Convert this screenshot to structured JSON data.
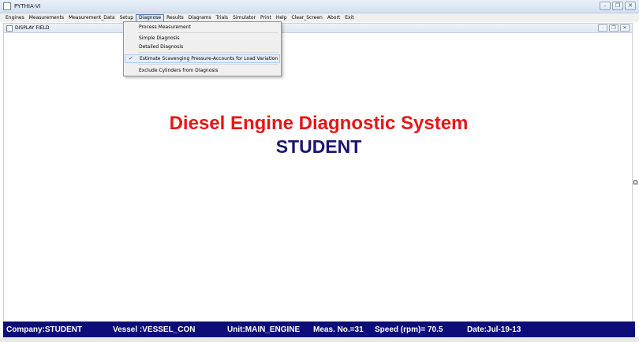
{
  "window": {
    "title": "PYTHIA-VI"
  },
  "menubar": {
    "items": [
      {
        "label": "Engines"
      },
      {
        "label": "Measurements"
      },
      {
        "label": "Measurement_Data"
      },
      {
        "label": "Setup"
      },
      {
        "label": "Diagnose"
      },
      {
        "label": "Results"
      },
      {
        "label": "Diagrams"
      },
      {
        "label": "Trials"
      },
      {
        "label": "Simulator"
      },
      {
        "label": "Print"
      },
      {
        "label": "Help"
      },
      {
        "label": "Clear_Screen"
      },
      {
        "label": "Abort"
      },
      {
        "label": "Exit"
      }
    ],
    "active": "Diagnose"
  },
  "diagnose_menu": {
    "items": [
      {
        "label": "Process Measurement"
      },
      {
        "label": "Simple Diagnosis"
      },
      {
        "label": "Detailed Diagnosis"
      },
      {
        "label": "Estimate Scavenging Pressure-Accounts for Load Variation",
        "checked": true
      },
      {
        "label": "Exclude Cylinders from Diagnosis"
      }
    ]
  },
  "display_field": {
    "title": "DISPLAY FIELD",
    "headline": "Diesel Engine Diagnostic System",
    "subline": "STUDENT",
    "colors": {
      "headline": "#e81616",
      "subline": "#1a1470"
    }
  },
  "statusbar": {
    "company": "Company:STUDENT",
    "vessel": "Vessel :VESSEL_CON",
    "unit": "Unit:MAIN_ENGINE",
    "meas_no": "Meas. No.=31",
    "speed": "Speed (rpm)=  70.5",
    "date": "Date:Jul-19-13",
    "color": "#0d0d7a"
  }
}
